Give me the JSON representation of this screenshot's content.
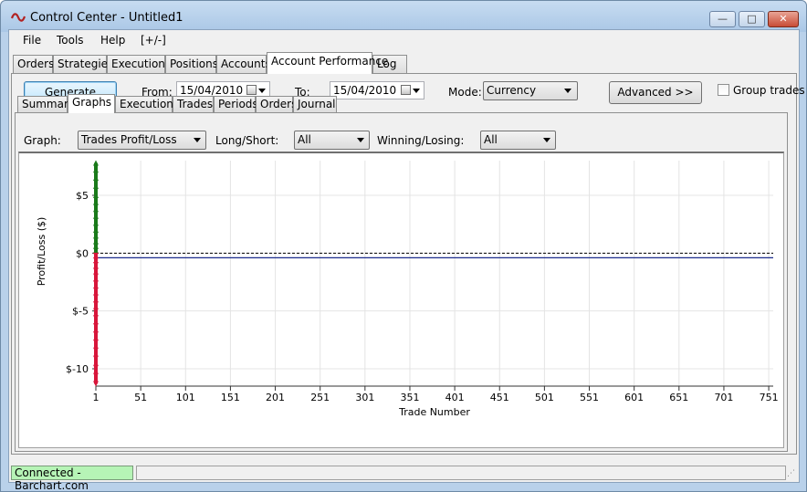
{
  "window": {
    "title": "Control Center - Untitled1",
    "minimize": "—",
    "maximize": "□",
    "close": "✕"
  },
  "menu": [
    "File",
    "Tools",
    "Help",
    "[+/-]"
  ],
  "tabs": [
    "Orders",
    "Strategies",
    "Executions",
    "Positions",
    "Accounts",
    "Account Performance",
    "Log"
  ],
  "active_tab": "Account Performance",
  "toolbar": {
    "generate": "Generate",
    "from_label": "From:",
    "from_value": "15/04/2010",
    "to_label": "To:",
    "to_value": "15/04/2010",
    "mode_label": "Mode:",
    "mode_value": "Currency",
    "advanced": "Advanced >>",
    "group_trades": "Group trades"
  },
  "subtabs": [
    "Summary",
    "Graphs",
    "Executions",
    "Trades",
    "Periods",
    "Orders",
    "Journal"
  ],
  "active_subtab": "Graphs",
  "graph_filters": {
    "graph_label": "Graph:",
    "graph_value": "Trades Profit/Loss",
    "longshort_label": "Long/Short:",
    "longshort_value": "All",
    "winlose_label": "Winning/Losing:",
    "winlose_value": "All"
  },
  "chart_data": {
    "type": "scatter",
    "xlabel": "Trade Number",
    "ylabel": "Profit/Loss ($)",
    "x_ticks": [
      "1",
      "51",
      "101",
      "151",
      "201",
      "251",
      "301",
      "351",
      "401",
      "451",
      "501",
      "551",
      "601",
      "651",
      "701",
      "751"
    ],
    "y_ticks": [
      {
        "label": "$5",
        "value": 5
      },
      {
        "label": "$0",
        "value": 0
      },
      {
        "label": "$-5",
        "value": -5
      },
      {
        "label": "$-10",
        "value": -10
      }
    ],
    "xlim": [
      1,
      756
    ],
    "ylim": [
      -11.5,
      8
    ],
    "grid": true,
    "zero_line": 0,
    "average_line": -0.4,
    "winning_color": "#1a7a1a",
    "losing_color": "#d8173b",
    "line_color": "#1a2a8c",
    "winning_points": [
      7.8,
      7.2,
      6.5,
      5.8,
      5.0,
      4.4,
      3.8,
      3.2,
      2.6,
      2.0,
      1.5,
      1.0,
      0.6,
      0.2
    ],
    "losing_points": [
      -0.2,
      -0.6,
      -1.0,
      -1.5,
      -2.0,
      -2.6,
      -3.2,
      -3.8,
      -4.4,
      -5.0,
      -5.6,
      -6.3,
      -7.0,
      -7.7,
      -8.4,
      -9.1,
      -9.9,
      -10.6,
      -11.3
    ]
  },
  "status": {
    "connection": "Connected - Barchart.com",
    "connection_color": "#b6f4b6"
  }
}
